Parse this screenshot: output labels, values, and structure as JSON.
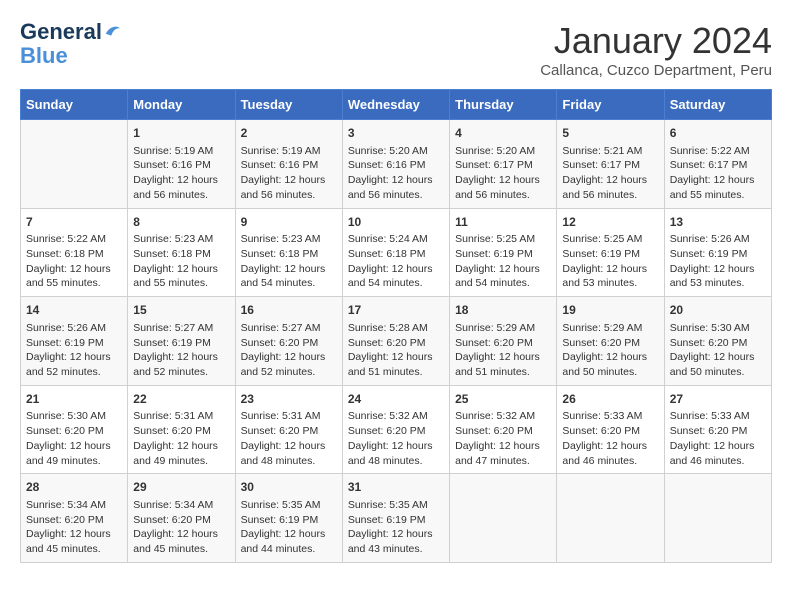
{
  "logo": {
    "line1": "General",
    "line2": "Blue"
  },
  "title": "January 2024",
  "subtitle": "Callanca, Cuzco Department, Peru",
  "headers": [
    "Sunday",
    "Monday",
    "Tuesday",
    "Wednesday",
    "Thursday",
    "Friday",
    "Saturday"
  ],
  "weeks": [
    [
      {
        "day": "",
        "info": ""
      },
      {
        "day": "1",
        "info": "Sunrise: 5:19 AM\nSunset: 6:16 PM\nDaylight: 12 hours\nand 56 minutes."
      },
      {
        "day": "2",
        "info": "Sunrise: 5:19 AM\nSunset: 6:16 PM\nDaylight: 12 hours\nand 56 minutes."
      },
      {
        "day": "3",
        "info": "Sunrise: 5:20 AM\nSunset: 6:16 PM\nDaylight: 12 hours\nand 56 minutes."
      },
      {
        "day": "4",
        "info": "Sunrise: 5:20 AM\nSunset: 6:17 PM\nDaylight: 12 hours\nand 56 minutes."
      },
      {
        "day": "5",
        "info": "Sunrise: 5:21 AM\nSunset: 6:17 PM\nDaylight: 12 hours\nand 56 minutes."
      },
      {
        "day": "6",
        "info": "Sunrise: 5:22 AM\nSunset: 6:17 PM\nDaylight: 12 hours\nand 55 minutes."
      }
    ],
    [
      {
        "day": "7",
        "info": "Sunrise: 5:22 AM\nSunset: 6:18 PM\nDaylight: 12 hours\nand 55 minutes."
      },
      {
        "day": "8",
        "info": "Sunrise: 5:23 AM\nSunset: 6:18 PM\nDaylight: 12 hours\nand 55 minutes."
      },
      {
        "day": "9",
        "info": "Sunrise: 5:23 AM\nSunset: 6:18 PM\nDaylight: 12 hours\nand 54 minutes."
      },
      {
        "day": "10",
        "info": "Sunrise: 5:24 AM\nSunset: 6:18 PM\nDaylight: 12 hours\nand 54 minutes."
      },
      {
        "day": "11",
        "info": "Sunrise: 5:25 AM\nSunset: 6:19 PM\nDaylight: 12 hours\nand 54 minutes."
      },
      {
        "day": "12",
        "info": "Sunrise: 5:25 AM\nSunset: 6:19 PM\nDaylight: 12 hours\nand 53 minutes."
      },
      {
        "day": "13",
        "info": "Sunrise: 5:26 AM\nSunset: 6:19 PM\nDaylight: 12 hours\nand 53 minutes."
      }
    ],
    [
      {
        "day": "14",
        "info": "Sunrise: 5:26 AM\nSunset: 6:19 PM\nDaylight: 12 hours\nand 52 minutes."
      },
      {
        "day": "15",
        "info": "Sunrise: 5:27 AM\nSunset: 6:19 PM\nDaylight: 12 hours\nand 52 minutes."
      },
      {
        "day": "16",
        "info": "Sunrise: 5:27 AM\nSunset: 6:20 PM\nDaylight: 12 hours\nand 52 minutes."
      },
      {
        "day": "17",
        "info": "Sunrise: 5:28 AM\nSunset: 6:20 PM\nDaylight: 12 hours\nand 51 minutes."
      },
      {
        "day": "18",
        "info": "Sunrise: 5:29 AM\nSunset: 6:20 PM\nDaylight: 12 hours\nand 51 minutes."
      },
      {
        "day": "19",
        "info": "Sunrise: 5:29 AM\nSunset: 6:20 PM\nDaylight: 12 hours\nand 50 minutes."
      },
      {
        "day": "20",
        "info": "Sunrise: 5:30 AM\nSunset: 6:20 PM\nDaylight: 12 hours\nand 50 minutes."
      }
    ],
    [
      {
        "day": "21",
        "info": "Sunrise: 5:30 AM\nSunset: 6:20 PM\nDaylight: 12 hours\nand 49 minutes."
      },
      {
        "day": "22",
        "info": "Sunrise: 5:31 AM\nSunset: 6:20 PM\nDaylight: 12 hours\nand 49 minutes."
      },
      {
        "day": "23",
        "info": "Sunrise: 5:31 AM\nSunset: 6:20 PM\nDaylight: 12 hours\nand 48 minutes."
      },
      {
        "day": "24",
        "info": "Sunrise: 5:32 AM\nSunset: 6:20 PM\nDaylight: 12 hours\nand 48 minutes."
      },
      {
        "day": "25",
        "info": "Sunrise: 5:32 AM\nSunset: 6:20 PM\nDaylight: 12 hours\nand 47 minutes."
      },
      {
        "day": "26",
        "info": "Sunrise: 5:33 AM\nSunset: 6:20 PM\nDaylight: 12 hours\nand 46 minutes."
      },
      {
        "day": "27",
        "info": "Sunrise: 5:33 AM\nSunset: 6:20 PM\nDaylight: 12 hours\nand 46 minutes."
      }
    ],
    [
      {
        "day": "28",
        "info": "Sunrise: 5:34 AM\nSunset: 6:20 PM\nDaylight: 12 hours\nand 45 minutes."
      },
      {
        "day": "29",
        "info": "Sunrise: 5:34 AM\nSunset: 6:20 PM\nDaylight: 12 hours\nand 45 minutes."
      },
      {
        "day": "30",
        "info": "Sunrise: 5:35 AM\nSunset: 6:19 PM\nDaylight: 12 hours\nand 44 minutes."
      },
      {
        "day": "31",
        "info": "Sunrise: 5:35 AM\nSunset: 6:19 PM\nDaylight: 12 hours\nand 43 minutes."
      },
      {
        "day": "",
        "info": ""
      },
      {
        "day": "",
        "info": ""
      },
      {
        "day": "",
        "info": ""
      }
    ]
  ]
}
